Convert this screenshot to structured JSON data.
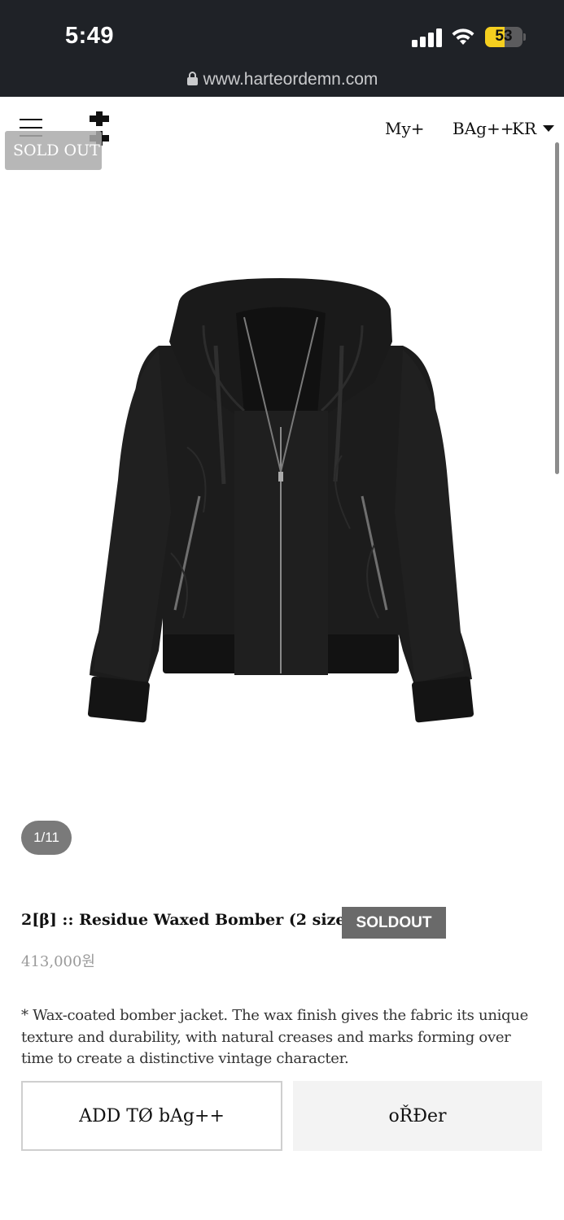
{
  "status_bar": {
    "time": "5:49",
    "battery_level": "53",
    "url": "www.harteordemn.com",
    "icons": [
      "signal-icon",
      "wifi-icon",
      "battery-icon",
      "lock-icon"
    ]
  },
  "header": {
    "menu_icon": "hamburger-menu-icon",
    "logo_icon": "double-cross-logo-icon",
    "soldout_tag": "SOLD OUT",
    "nav": {
      "my": "My+",
      "bag": "BAg++",
      "lang": "KR"
    }
  },
  "gallery": {
    "counter": "1/11",
    "image": "black hooded waxed bomber jacket"
  },
  "product": {
    "title": "2[β] :: Residue Waxed Bomber (2 sizes)",
    "badge": "SOLDOUT",
    "price": "413,000원",
    "description": "* Wax-coated bomber jacket. The wax finish gives the fabric its unique texture and durability, with natural creases and marks forming over time to create a distinctive vintage character."
  },
  "actions": {
    "add_to_bag": "ADD TØ bAg++",
    "order": "oŘĐer"
  },
  "colors": {
    "status_bar_bg": "#1f2227",
    "battery_yellow": "#f5cf1f",
    "badge_bg": "#6a6a6a",
    "price_gray": "#9a9a9a"
  }
}
